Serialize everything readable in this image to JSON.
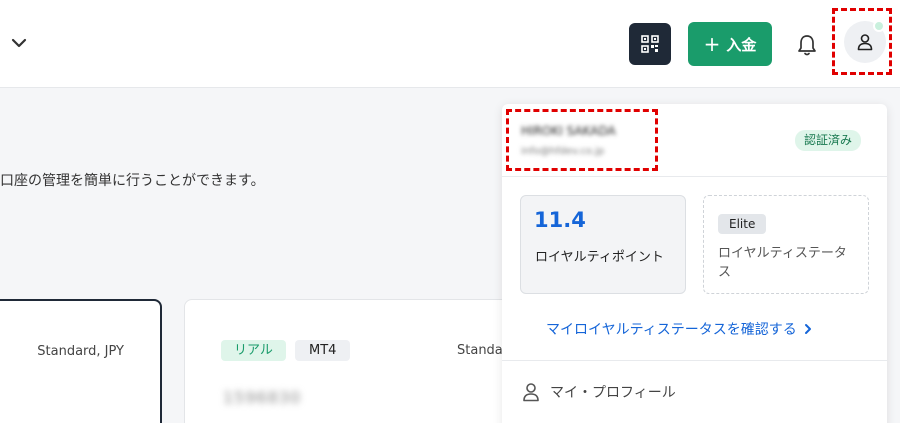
{
  "header": {
    "deposit_label": "入金"
  },
  "page": {
    "description": "口座の管理を簡単に行うことができます。"
  },
  "accounts": [
    {
      "type": "Standard, JPY"
    },
    {
      "badge_real": "リアル",
      "badge_platform": "MT4",
      "type": "Standa",
      "account_number": "1596830"
    }
  ],
  "user_menu": {
    "name": "HIROKI SAKADA",
    "email": "info@hfdev.co.jp",
    "verified_badge": "認証済み",
    "loyalty_points_value": "11.4",
    "loyalty_points_label": "ロイヤルティポイント",
    "loyalty_status_value": "Elite",
    "loyalty_status_label": "ロイヤルティステータス",
    "loyalty_link": "マイロイヤルティステータスを確認する",
    "profile_label": "マイ・プロフィール"
  },
  "colors": {
    "accent_green": "#1a9c6b",
    "link_blue": "#1565d8",
    "dark": "#1f2937",
    "highlight_red": "#e00000"
  },
  "icons": [
    "chevron-down-icon",
    "qr-code-icon",
    "plus-icon",
    "bell-icon",
    "user-icon",
    "chevron-right-icon"
  ]
}
